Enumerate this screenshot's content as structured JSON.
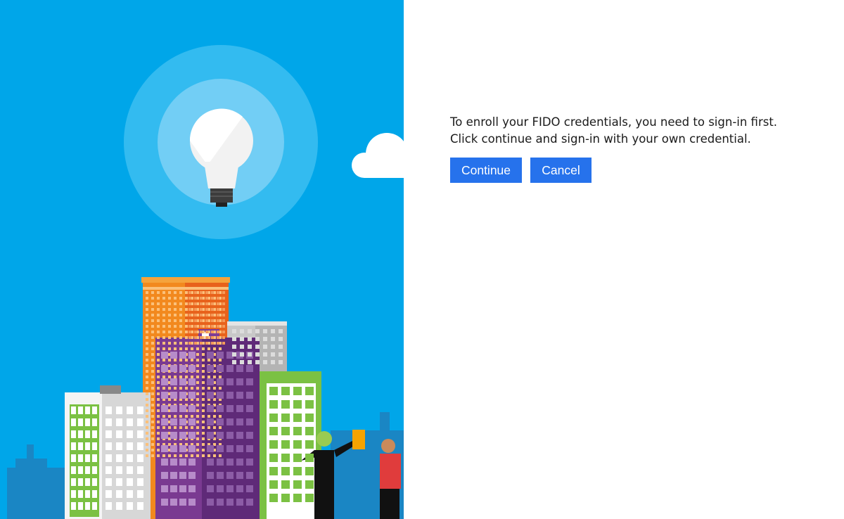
{
  "dialog": {
    "message_line_1": "To enroll your FIDO credentials, you need to sign-in first.",
    "message_line_2": "Click continue and sign-in with your own credential.",
    "continue_label": "Continue",
    "cancel_label": "Cancel"
  },
  "illustration": {
    "subject": "lightbulb-over-city-skyline",
    "icons": [
      "lightbulb-icon",
      "cloud-icon",
      "city-buildings",
      "people-figures"
    ]
  },
  "colors": {
    "sky": "#00a6e9",
    "button": "#2672ec",
    "button_text": "#ffffff",
    "text": "#1a1a1a",
    "background": "#ffffff"
  }
}
